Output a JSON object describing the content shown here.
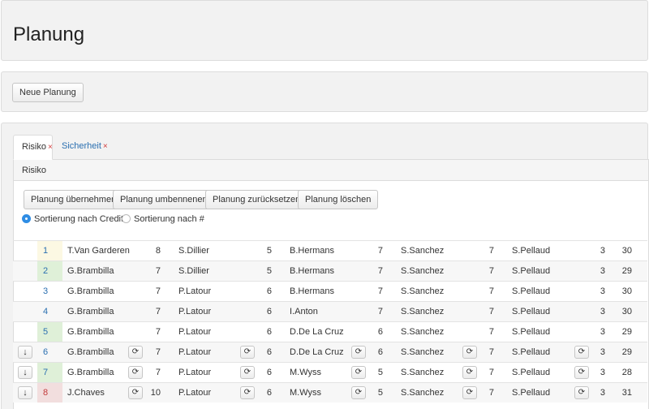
{
  "page": {
    "title": "Planung"
  },
  "actions": {
    "new_label": "Neue Planung"
  },
  "tabs": [
    {
      "label": "Risiko",
      "close": "×",
      "active": true
    },
    {
      "label": "Sicherheit",
      "close": "×",
      "active": false
    }
  ],
  "panel": {
    "heading": "Risiko",
    "buttons": [
      "Planung übernehmen",
      "Planung umbennenen",
      "Planung zurücksetzen",
      "Planung löschen"
    ],
    "sort_options": [
      {
        "label": "Sortierung nach Credits",
        "selected": true
      },
      {
        "label": "Sortierung nach #",
        "selected": false
      }
    ]
  },
  "icons": {
    "move_down": "arrow-down-icon",
    "swap": "refresh-icon"
  },
  "colors": {
    "accent": "#2a6fb0",
    "row_yellow": "#fcf8e3",
    "row_green": "#dff0d8",
    "row_red": "#f2dede",
    "close_x": "#d23a3a"
  },
  "rows": [
    {
      "idx": "1",
      "tint": "yellow",
      "controls": false,
      "riders": [
        "T.Van Garderen",
        "S.Dillier",
        "B.Hermans",
        "S.Sanchez",
        "S.Pellaud"
      ],
      "credits": [
        "8",
        "5",
        "7",
        "7",
        "3"
      ],
      "total": "30"
    },
    {
      "idx": "2",
      "tint": "green",
      "controls": false,
      "riders": [
        "G.Brambilla",
        "S.Dillier",
        "B.Hermans",
        "S.Sanchez",
        "S.Pellaud"
      ],
      "credits": [
        "7",
        "5",
        "7",
        "7",
        "3"
      ],
      "total": "29"
    },
    {
      "idx": "3",
      "tint": "",
      "controls": false,
      "riders": [
        "G.Brambilla",
        "P.Latour",
        "B.Hermans",
        "S.Sanchez",
        "S.Pellaud"
      ],
      "credits": [
        "7",
        "6",
        "7",
        "7",
        "3"
      ],
      "total": "30"
    },
    {
      "idx": "4",
      "tint": "",
      "controls": false,
      "riders": [
        "G.Brambilla",
        "P.Latour",
        "I.Anton",
        "S.Sanchez",
        "S.Pellaud"
      ],
      "credits": [
        "7",
        "6",
        "7",
        "7",
        "3"
      ],
      "total": "30"
    },
    {
      "idx": "5",
      "tint": "green",
      "controls": false,
      "riders": [
        "G.Brambilla",
        "P.Latour",
        "D.De La Cruz",
        "S.Sanchez",
        "S.Pellaud"
      ],
      "credits": [
        "7",
        "6",
        "6",
        "7",
        "3"
      ],
      "total": "29"
    },
    {
      "idx": "6",
      "tint": "",
      "controls": true,
      "riders": [
        "G.Brambilla",
        "P.Latour",
        "D.De La Cruz",
        "S.Sanchez",
        "S.Pellaud"
      ],
      "credits": [
        "7",
        "6",
        "6",
        "7",
        "3"
      ],
      "total": "29"
    },
    {
      "idx": "7",
      "tint": "green",
      "controls": true,
      "riders": [
        "G.Brambilla",
        "P.Latour",
        "M.Wyss",
        "S.Sanchez",
        "S.Pellaud"
      ],
      "credits": [
        "7",
        "6",
        "5",
        "7",
        "3"
      ],
      "total": "28"
    },
    {
      "idx": "8",
      "tint": "red",
      "controls": true,
      "riders": [
        "J.Chaves",
        "P.Latour",
        "M.Wyss",
        "S.Sanchez",
        "S.Pellaud"
      ],
      "credits": [
        "10",
        "6",
        "5",
        "7",
        "3"
      ],
      "total": "31"
    }
  ]
}
